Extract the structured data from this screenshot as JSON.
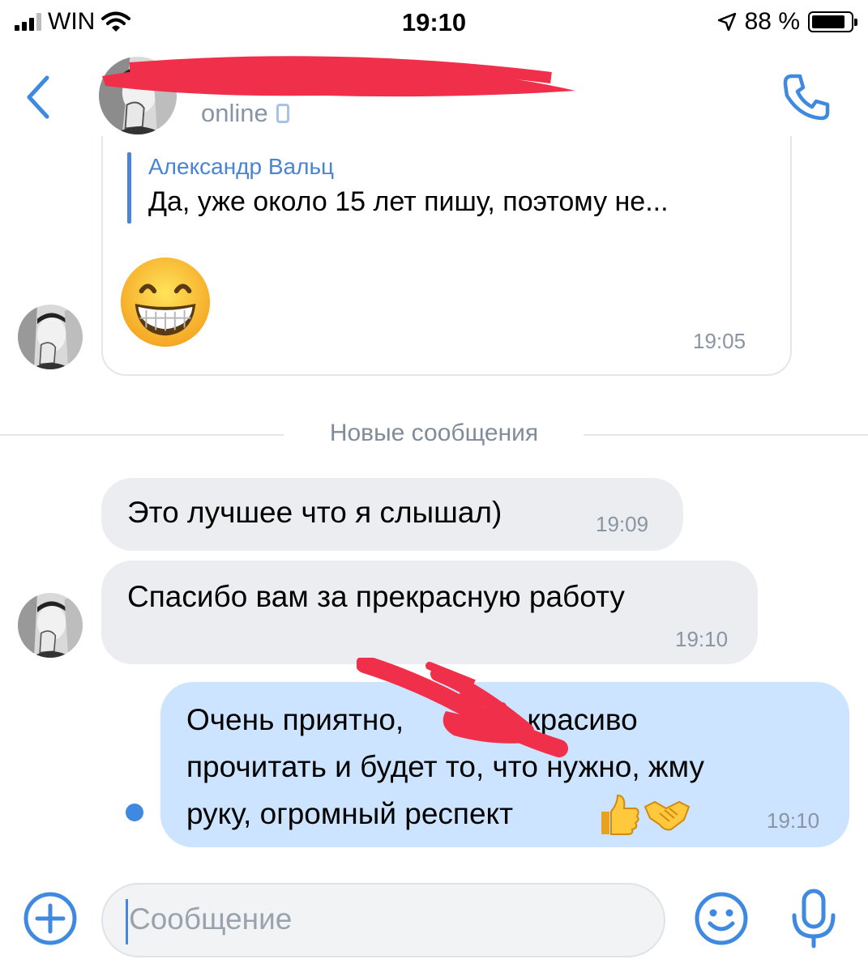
{
  "status_bar": {
    "carrier": "WIN",
    "time": "19:10",
    "battery": "88 %",
    "battery_level": 0.88
  },
  "header": {
    "status": "online"
  },
  "messages": {
    "card": {
      "quote_author": "Александр Вальц",
      "quote_text": "Да, уже около 15 лет пишу, поэтому не...",
      "time": "19:05"
    },
    "divider": "Новые сообщения",
    "m1": {
      "text": "Это лучшее что я слышал)",
      "time": "19:09"
    },
    "m2": {
      "text": "Спасибо вам за прекрасную работу",
      "time": "19:10"
    },
    "out": {
      "line1": "Очень приятно,         ис, красиво",
      "line2": "прочитать и будет то, что нужно, жму",
      "line3": "руку, огромный респект",
      "time": "19:10"
    }
  },
  "composer": {
    "placeholder": "Сообщение"
  },
  "colors": {
    "accent": "#3f8ae0",
    "incoming_bubble": "#ebedf0",
    "outgoing_bubble": "#cce4ff",
    "redaction": "#f0304a"
  }
}
